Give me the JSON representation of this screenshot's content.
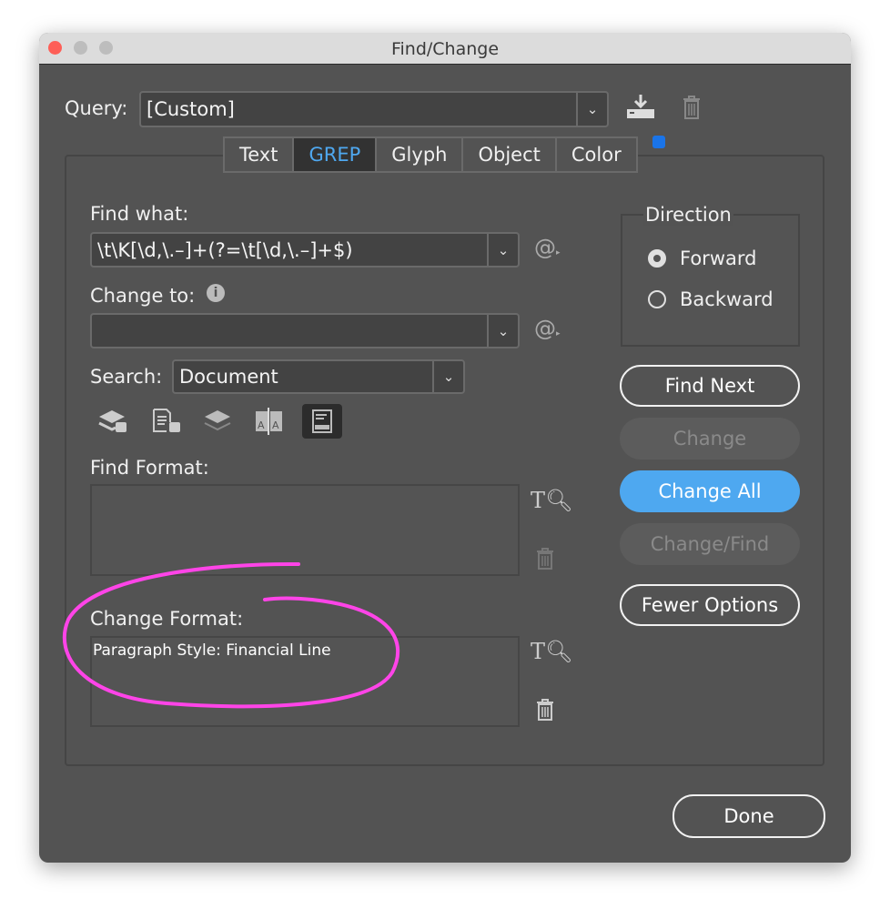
{
  "window": {
    "title": "Find/Change"
  },
  "query": {
    "label": "Query:",
    "value": "[Custom]"
  },
  "tabs": [
    {
      "label": "Text"
    },
    {
      "label": "GREP",
      "selected": true
    },
    {
      "label": "Glyph"
    },
    {
      "label": "Object"
    },
    {
      "label": "Color"
    }
  ],
  "find": {
    "label": "Find what:",
    "value": "\\t\\K[\\d,\\.–]+(?=\\t[\\d,\\.–]+$)"
  },
  "change": {
    "label": "Change to:",
    "value": ""
  },
  "search": {
    "label": "Search:",
    "value": "Document"
  },
  "find_format": {
    "label": "Find Format:",
    "value": ""
  },
  "change_format": {
    "label": "Change Format:",
    "value": "Paragraph Style: Financial Line"
  },
  "direction": {
    "label": "Direction",
    "options": [
      {
        "label": "Forward",
        "selected": true
      },
      {
        "label": "Backward",
        "selected": false
      }
    ]
  },
  "buttons": {
    "find_next": "Find Next",
    "change": "Change",
    "change_all": "Change All",
    "change_find": "Change/Find",
    "fewer_options": "Fewer Options",
    "done": "Done"
  },
  "colors": {
    "accent": "#4ea8f0",
    "annotation": "#ff44e8",
    "background": "#535353"
  }
}
